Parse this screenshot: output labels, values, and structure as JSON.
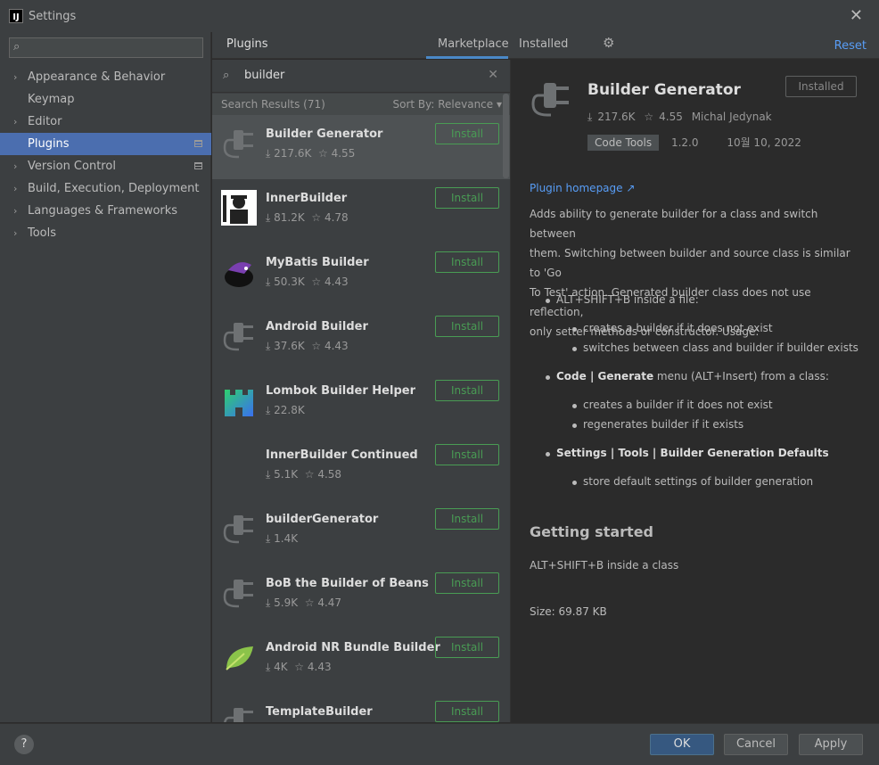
{
  "window": {
    "title": "Settings",
    "app_icon": "IJ"
  },
  "sidebar": {
    "search_placeholder": "",
    "items": [
      {
        "label": "Appearance & Behavior",
        "expandable": true
      },
      {
        "label": "Keymap",
        "expandable": false
      },
      {
        "label": "Editor",
        "expandable": true
      },
      {
        "label": "Plugins",
        "expandable": false,
        "selected": true
      },
      {
        "label": "Version Control",
        "expandable": true
      },
      {
        "label": "Build, Execution, Deployment",
        "expandable": true
      },
      {
        "label": "Languages & Frameworks",
        "expandable": true
      },
      {
        "label": "Tools",
        "expandable": true
      }
    ]
  },
  "header": {
    "title": "Plugins",
    "tabs": [
      "Marketplace",
      "Installed"
    ],
    "active_tab": "Marketplace",
    "reset_label": "Reset"
  },
  "search": {
    "query": "builder",
    "results_label": "Search Results (71)",
    "sort_label": "Sort By: Relevance"
  },
  "plugins": [
    {
      "name": "Builder Generator",
      "downloads": "217.6K",
      "rating": "4.55",
      "install": "Install",
      "icon": "plug-icon"
    },
    {
      "name": "InnerBuilder",
      "downloads": "81.2K",
      "rating": "4.78",
      "install": "Install",
      "icon": "builder-worker-icon"
    },
    {
      "name": "MyBatis Builder",
      "downloads": "50.3K",
      "rating": "4.43",
      "install": "Install",
      "icon": "mybatis-bird-icon"
    },
    {
      "name": "Android Builder",
      "downloads": "37.6K",
      "rating": "4.43",
      "install": "Install",
      "icon": "plug-icon"
    },
    {
      "name": "Lombok Builder Helper",
      "downloads": "22.8K",
      "rating": "",
      "install": "Install",
      "icon": "castle-icon"
    },
    {
      "name": "InnerBuilder Continued",
      "downloads": "5.1K",
      "rating": "4.58",
      "install": "Install",
      "icon": ""
    },
    {
      "name": "builderGenerator",
      "downloads": "1.4K",
      "rating": "",
      "install": "Install",
      "icon": "plug-icon"
    },
    {
      "name": "BoB the Builder of Beans",
      "downloads": "5.9K",
      "rating": "4.47",
      "install": "Install",
      "icon": "plug-icon"
    },
    {
      "name": "Android NR Bundle Builder",
      "downloads": "4K",
      "rating": "4.43",
      "install": "Install",
      "icon": "leaf-icon"
    },
    {
      "name": "TemplateBuilder",
      "downloads": "",
      "rating": "",
      "install": "Install",
      "icon": "plug-icon"
    }
  ],
  "detail": {
    "title": "Builder Generator",
    "installed_label": "Installed",
    "downloads": "217.6K",
    "rating": "4.55",
    "author": "Michal Jedynak",
    "tag": "Code Tools",
    "version": "1.2.0",
    "date": "10월 10, 2022",
    "homepage": "Plugin homepage ↗",
    "description": [
      "Adds ability to generate builder for a class and switch between",
      "them. Switching between builder and source class is similar to 'Go",
      "To Test' action. Generated builder class does not use reflection,",
      "only setter methods or constructor. Usage:"
    ],
    "b1": "ALT+SHIFT+B inside a file:",
    "b1_1": "creates a builder if it does not exist",
    "b1_2": "switches between class and builder if builder exists",
    "b2_bold": "Code | Generate",
    "b2_rest": " menu (ALT+Insert) from a class:",
    "b2_1": "creates a builder if it does not exist",
    "b2_2": "regenerates builder if it exists",
    "b3_bold": "Settings | Tools | Builder Generation Defaults",
    "b3_1": "store default settings of builder generation",
    "getting_started": "Getting started",
    "gs_text": "ALT+SHIFT+B inside a class",
    "size": "Size: 69.87 KB"
  },
  "footer": {
    "help": "?",
    "ok": "OK",
    "cancel": "Cancel",
    "apply": "Apply"
  },
  "colors": {
    "accent": "#4b6eaf",
    "install_green": "#499c54",
    "link_blue": "#589df6"
  }
}
